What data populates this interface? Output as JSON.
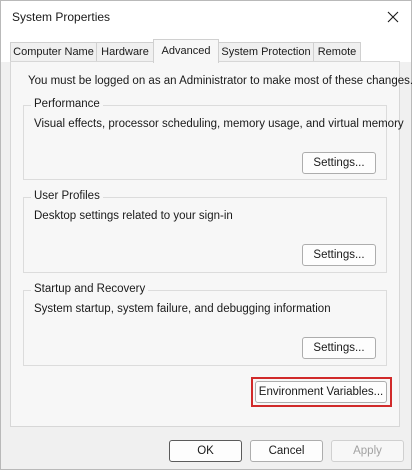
{
  "window": {
    "title": "System Properties"
  },
  "tabs": [
    {
      "label": "Computer Name",
      "active": false
    },
    {
      "label": "Hardware",
      "active": false
    },
    {
      "label": "Advanced",
      "active": true
    },
    {
      "label": "System Protection",
      "active": false
    },
    {
      "label": "Remote",
      "active": false
    }
  ],
  "panel": {
    "admin_note": "You must be logged on as an Administrator to make most of these changes.",
    "groups": {
      "performance": {
        "title": "Performance",
        "description": "Visual effects, processor scheduling, memory usage, and virtual memory",
        "button": "Settings..."
      },
      "user_profiles": {
        "title": "User Profiles",
        "description": "Desktop settings related to your sign-in",
        "button": "Settings..."
      },
      "startup_recovery": {
        "title": "Startup and Recovery",
        "description": "System startup, system failure, and debugging information",
        "button": "Settings..."
      }
    },
    "environment_button": "Environment Variables...",
    "highlight_color": "#d12a2a"
  },
  "footer": {
    "ok": "OK",
    "cancel": "Cancel",
    "apply": "Apply"
  },
  "icons": {
    "close": "close-icon"
  }
}
